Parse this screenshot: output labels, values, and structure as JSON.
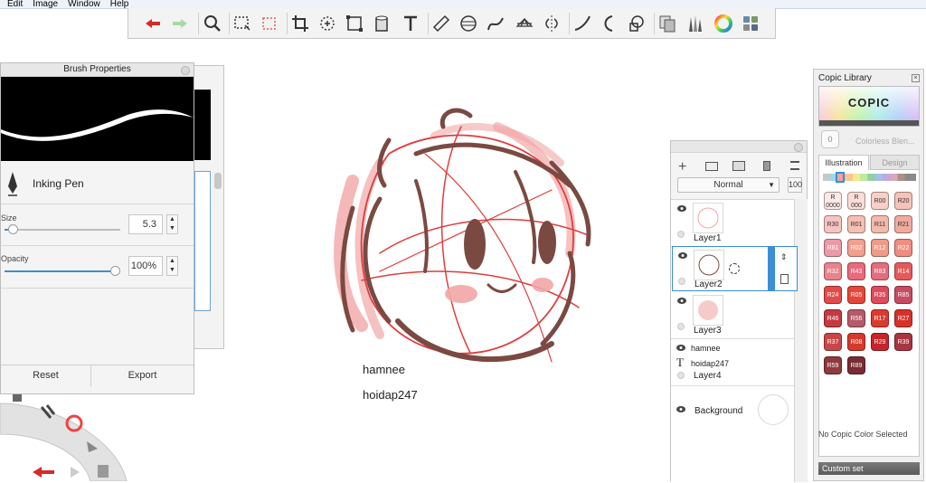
{
  "menu": [
    "Edit",
    "Image",
    "Window",
    "Help"
  ],
  "toolbar_icons": [
    "undo-icon",
    "redo-icon",
    "zoom-icon",
    "select-icon",
    "magic-select-icon",
    "crop-icon",
    "transform-icon",
    "distort-icon",
    "fill-icon",
    "text-icon",
    "ruler-icon",
    "ellipse-guide-icon",
    "french-curve-icon",
    "perspective-icon",
    "symmetry-icon",
    "stroke-icon",
    "predictive-icon",
    "shape-icon",
    "copy-icon",
    "brush-library-icon",
    "color-wheel-icon",
    "grid-icon"
  ],
  "canvas": {
    "text1": "hamnee",
    "text2": "hoidap247"
  },
  "brush": {
    "title": "Brush Properties",
    "name": "Inking Pen",
    "size_label": "Size",
    "size_value": "5.3",
    "opacity_label": "Opacity",
    "opacity_value": "100%",
    "size_fraction": 0.05,
    "opacity_fraction": 1.0,
    "reset": "Reset",
    "export": "Export"
  },
  "layers": {
    "blend_mode": "Normal",
    "opacity": "100",
    "items": [
      {
        "name": "Layer1"
      },
      {
        "name": "Layer2"
      },
      {
        "name": "Layer3"
      },
      {
        "name": "hamnee"
      },
      {
        "name": "hoidap247"
      },
      {
        "name": "Layer4"
      },
      {
        "name": "Background"
      }
    ]
  },
  "copic": {
    "title": "Copic Library",
    "logo": "COPIC",
    "colorless": "Colorless Blen...",
    "colorless_code": "0",
    "tabs": [
      "Illustration",
      "Design"
    ],
    "swatches": [
      {
        "code": "R\n0000",
        "color": "#fbe9e6",
        "light": true
      },
      {
        "code": "R\n000",
        "color": "#fbdcd8",
        "light": true
      },
      {
        "code": "R00",
        "color": "#f9d0c8",
        "light": true
      },
      {
        "code": "R20",
        "color": "#f7c2b8",
        "light": true
      },
      {
        "code": "R30",
        "color": "#f6c3c0",
        "light": true
      },
      {
        "code": "R01",
        "color": "#f5bfb3",
        "light": true
      },
      {
        "code": "R11",
        "color": "#f2b9ac",
        "light": true
      },
      {
        "code": "R21",
        "color": "#f0aa9e",
        "light": true
      },
      {
        "code": "R81",
        "color": "#eb9aa8",
        "light": false
      },
      {
        "code": "R02",
        "color": "#f0a08c",
        "light": false
      },
      {
        "code": "R12",
        "color": "#ef9b88",
        "light": false
      },
      {
        "code": "R22",
        "color": "#ee8d80",
        "light": false
      },
      {
        "code": "R32",
        "color": "#e8848a",
        "light": false
      },
      {
        "code": "R43",
        "color": "#e86a7b",
        "light": false
      },
      {
        "code": "R83",
        "color": "#e46d7d",
        "light": false
      },
      {
        "code": "R14",
        "color": "#e6595b",
        "light": false
      },
      {
        "code": "R24",
        "color": "#e34b4a",
        "light": false
      },
      {
        "code": "R05",
        "color": "#e44639",
        "light": false
      },
      {
        "code": "R35",
        "color": "#df4a5c",
        "light": false
      },
      {
        "code": "R85",
        "color": "#c84a63",
        "light": false
      },
      {
        "code": "R46",
        "color": "#c33a40",
        "light": false
      },
      {
        "code": "R56",
        "color": "#b65a68",
        "light": false
      },
      {
        "code": "R17",
        "color": "#db3b2f",
        "light": false
      },
      {
        "code": "R27",
        "color": "#d8312a",
        "light": false
      },
      {
        "code": "R37",
        "color": "#c94748",
        "light": false
      },
      {
        "code": "R08",
        "color": "#d6382c",
        "light": false
      },
      {
        "code": "R29",
        "color": "#c6252b",
        "light": false
      },
      {
        "code": "R39",
        "color": "#a8353f",
        "light": false
      },
      {
        "code": "R59",
        "color": "#8f3a3d",
        "light": false
      },
      {
        "code": "R89",
        "color": "#7a2b33",
        "light": false
      }
    ],
    "status": "No Copic Color Selected",
    "custom_set": "Custom set"
  },
  "colors": {
    "accent": "#3a8fd6",
    "sketch_red": "#e03c3c",
    "sketch_pink": "#f2a6a6",
    "sketch_brown": "#7a4a42"
  }
}
